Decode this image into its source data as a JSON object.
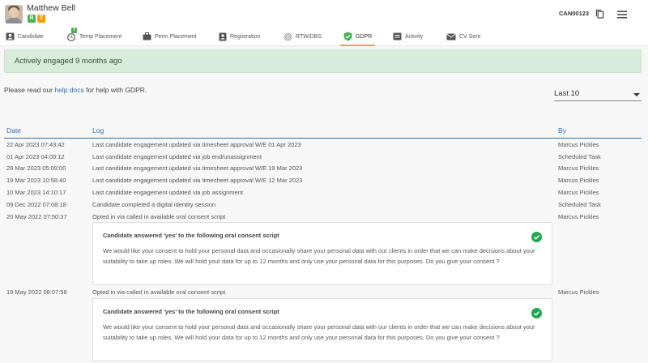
{
  "header": {
    "candidate_name": "Matthew Bell",
    "badges": [
      "R",
      "T"
    ],
    "candidate_id": "CAN00123"
  },
  "tabs": [
    {
      "label": "Candidate",
      "icon": "person-card-icon"
    },
    {
      "label": "Temp Placement",
      "icon": "temp-placement-icon",
      "badge": "T"
    },
    {
      "label": "Perm Placement",
      "icon": "briefcase-icon"
    },
    {
      "label": "Registration",
      "icon": "registration-icon"
    },
    {
      "label": "RTW/DBS",
      "icon": "fingerprint-icon"
    },
    {
      "label": "GDPR",
      "icon": "shield-check-icon",
      "active": true
    },
    {
      "label": "Activity",
      "icon": "activity-icon"
    },
    {
      "label": "CV Sent",
      "icon": "envelope-icon"
    }
  ],
  "alert": {
    "text": "Actively engaged 9 months ago"
  },
  "help": {
    "before": "Please read our ",
    "link": "help docs",
    "after": " for help with GDPR."
  },
  "filter": {
    "selected": "Last 10"
  },
  "table": {
    "headers": {
      "date": "Date",
      "log": "Log",
      "by": "By"
    },
    "rows": [
      {
        "date": "22 Apr 2023 07:43:42",
        "log": "Last candidate engagement updated via timesheet approval W/E 01 Apr 2023",
        "by": "Marcus Pickles"
      },
      {
        "date": "01 Apr 2023 04:00:12",
        "log": "Last candidate engagement updated via job end/unassignment",
        "by": "Scheduled Task"
      },
      {
        "date": "29 Mar 2023 05:09:00",
        "log": "Last candidate engagement updated via timesheet approval W/E 19 Mar 2023",
        "by": "Marcus Pickles"
      },
      {
        "date": "19 Mar 2023 10:58:40",
        "log": "Last candidate engagement updated via timesheet approval W/E 12 Mar 2023",
        "by": "Marcus Pickles"
      },
      {
        "date": "10 Mar 2023 14:10:17",
        "log": "Last candidate engagement updated via job assignment",
        "by": "Marcus Pickles"
      },
      {
        "date": "09 Dec 2022 07:08:18",
        "log": "Candidate completed a digital identity session",
        "by": "Scheduled Task"
      },
      {
        "date": "20 May 2022 07:50:37",
        "log": "Opted in via called in available oral consent script",
        "by": "Marcus Pickles"
      },
      {
        "date": "19 May 2022 08:07:58",
        "log": "Opted in via called in available oral consent script",
        "by": "Marcus Pickles"
      }
    ],
    "consent_cards": [
      {
        "title": "Candidate answered 'yes' to the following oral consent script",
        "text": "We would like your consent to hold your personal data and occasionally share your personal data with our clients in order that we can make decisions about your suitability to take up roles. We will hold your data for up to 12 months and only use your personal data for this purposes. Do you give your consent ?"
      },
      {
        "title": "Candidate answered 'yes' to the following oral consent script",
        "text": "We would like your consent to hold your personal data and occasionally share your personal data with our clients in order that we can make decisions about your suitability to take up roles. We will hold your data for up to 12 months and only use your personal data for this purposes. Do you give your consent ?"
      }
    ]
  },
  "colors": {
    "accent": "#2a72b5",
    "active_tab": "#f0a04b",
    "success": "#4caf50",
    "alert_bg": "#d7ecda"
  }
}
